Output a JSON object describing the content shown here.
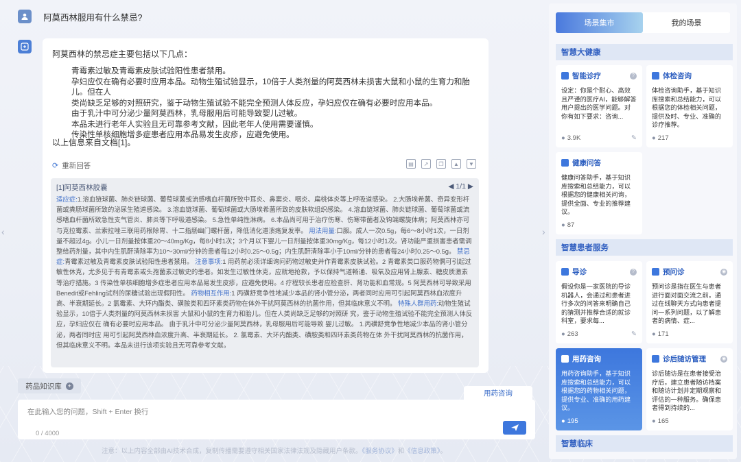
{
  "question": "阿莫西林服用有什么禁忌?",
  "answer": {
    "intro": "阿莫西林的禁忌症主要包括以下几点：",
    "points": [
      "青霉素过敏及青霉素皮肤试验阳性患者禁用。",
      "孕妇应仅在确有必要时应用本品。动物生殖试验显示，10倍于人类剂量的阿莫西林未损害大鼠和小鼠的生育力和胎儿。但在人",
      "类尚缺乏足够的对照研究，鉴于动物生殖试验不能完全预测人体反应，孕妇应仅在确有必要时应用本品。",
      "由于乳汁中可分泌少量阿莫西林，乳母服用后可能导致婴儿过敏。",
      "本品未进行老年人实验且无可靠参考文献，因此老年人使用需要谨慎。",
      "传染性单核细胞增多症患者应用本品易发生皮疹，应避免使用。"
    ],
    "source": "以上信息来自文档[1]。",
    "regen_label": "重新回答"
  },
  "reference": {
    "title": "[1]阿莫西林胶囊",
    "pager": "◀ 1/1 ▶",
    "segments": [
      {
        "k": "适应症:",
        "t": "1.溶血链球菌、肺炎链球菌、葡萄球菌或流感嗜血杆菌所致中耳炎、鼻窦炎、咽炎、扁桃体炎等上呼吸道感染。 2.大肠埃希菌、奇异变形杆菌或粪肠球菌所致的泌尿生殖道感染。 3.溶血链球菌、葡萄球菌或大肠埃希菌所致的皮肤软组织感染。 4.溶血链球菌、肺炎链球菌、葡萄球菌或流感嗜血杆菌所致急性支气管炎、肺炎等下呼吸道感染。 5.急性单纯性淋病。 6.本品尚可用于治疗伤寒、伤寒带菌者及钩端螺旋体病；阿莫西林亦可与克拉霉素、兰索拉唑三联用药根除胃、十二指肠幽门螺杆菌，降低消化道溃疡复发率。"
      },
      {
        "k": "用法用量:",
        "t": "口服。成人一次0.5g，每6～8小时1次，一日剂量不超过4g。小儿一日剂量按体重20～40mg/Kg，每8小时1次；3个月以下婴儿一日剂量按体重30mg/Kg，每12小时1次。肾功能严重损害患者需调整给药剂量，其中内生肌酐清除率为10～30ml/分钟的患者每12小时0.25～0.5g；内生肌酐清除率小于10ml/分钟的患者每24小时0.25～0.5g。"
      },
      {
        "k": "禁忌症:",
        "t": "青霉素过敏及青霉素皮肤试验阳性患者禁用。"
      },
      {
        "k": "注意事项:",
        "t": "1 用药前必须详细询问药物过敏史并作青霉素皮肤试验。2 青霉素类口服药物偶可引起过敏性休克，尤多见于有青霉素或头孢菌素过敏史的患者。如发生过敏性休克，应就地抢救，予以保持气道畅通、吸氧及应用肾上腺素、糖皮质激素等治疗措施。3 传染性单核细胞增多症患者应用本品易发生皮疹，应避免使用。4 疗程较长患者应检查肝、肾功能和血常规。5 阿莫西林可导致采用Benedit或Fehling试剂的尿糖试验出现假阳性。"
      },
      {
        "k": "药物相互作用:",
        "t": "1 丙磺舒竞争性地减少本品的肾小管分泌，两者同时应用可引起阿莫西林血浓度升高、半衰期延长。2 氯霉素、大环内酯类、磺胺类和四环素类药物在体外干扰阿莫西林的抗菌作用，但其临床意义不明。"
      },
      {
        "k": "特殊人群用药:",
        "t": "动物生殖试验显示，10倍于人类剂量的阿莫西林未损害 大鼠和小鼠的生育力和胎儿。但在人类尚缺乏足够的对照研 究，鉴于动物生殖试验不能完全预测人体反应，孕妇应仅在 确有必要时应用本品。 由于乳汁中可分泌少量阿莫西林，乳母服用后可能导致 婴儿过敏。"
      },
      {
        "k": "",
        "t": "1.丙磺舒竞争性地减少本品的肾小管分泌，两者同时应 用可引起阿莫西林血浓度升高、半衰期延长。 2. 氯霉素、大环内酯类、磺胺类和四环素类药物在体 外干扰阿莫西林的抗菌作用，但其临床意义不明。本品未进行该项实验且无可靠参考文献。"
      }
    ]
  },
  "knowledge_base_label": "药品知识库",
  "active_scene_tab": "用药咨询",
  "input": {
    "placeholder": "在此输入您的问题，Shift + Enter 换行",
    "counter": "0 / 4000"
  },
  "disclaimer": {
    "text": "注意：以上内容全部由AI技术合成，复制传播需要遵守相关国家法律法规及隐藏用户条款。",
    "link1": "《服务协议》",
    "and": "和",
    "link2": "《信息政策》",
    "end": "。"
  },
  "right_panel": {
    "tabs": [
      "场景集市",
      "我的场景"
    ],
    "sections": [
      {
        "title": "智慧大健康",
        "cards": [
          {
            "title": "智能诊疗",
            "desc": "设定：你是个耐心、高效且严谨的医疗AI，能够解答用户提出的医学问题。对你有如下要求：咨询...",
            "count": "3.9K",
            "editable": true
          },
          {
            "title": "体检咨询",
            "desc": "体检咨询助手，基于知识库搜索和总结能力，可以根据您的体检相关问题，提供及时、专业、准确的诊疗推荐。",
            "count": "217",
            "editable": false
          },
          {
            "title": "健康问答",
            "desc": "健康问答助手，基于知识库搜索和总结能力，可以根据您的健康相关问询，提供全面、专业的推荐建议。",
            "count": "87",
            "editable": false
          }
        ]
      },
      {
        "title": "智慧患者服务",
        "cards": [
          {
            "title": "导诊",
            "desc": "假设你是一家医院的导诊机器人，会通过和患者进行多次的问答来明确自己的猜测并推荐合适的就诊科室，要求每...",
            "count": "263",
            "editable": true
          },
          {
            "title": "预问诊",
            "desc": "预问诊是指在医生与患者进行面对面交流之前，通过在线聊天方式向患者提问一系列问题，以了解患者的病情、症...",
            "count": "171",
            "editable": false
          },
          {
            "title": "用药咨询",
            "desc": "用药咨询助手，基于知识库搜索和总结能力，可以根据您的药物相关问题，提供专业、准确的用药建议。",
            "count": "195",
            "editable": false
          },
          {
            "title": "诊后随访管理",
            "desc": "诊后随访是在患者接受治疗后，建立患者随访档案和随访计划并定期观察和评估的一种服务。确保患者得到持续的...",
            "count": "165",
            "editable": false
          }
        ]
      },
      {
        "title": "智慧临床",
        "cards": []
      }
    ]
  },
  "colors": {
    "accent": "#3d77dd",
    "section_bg": "#dfe7f5"
  }
}
